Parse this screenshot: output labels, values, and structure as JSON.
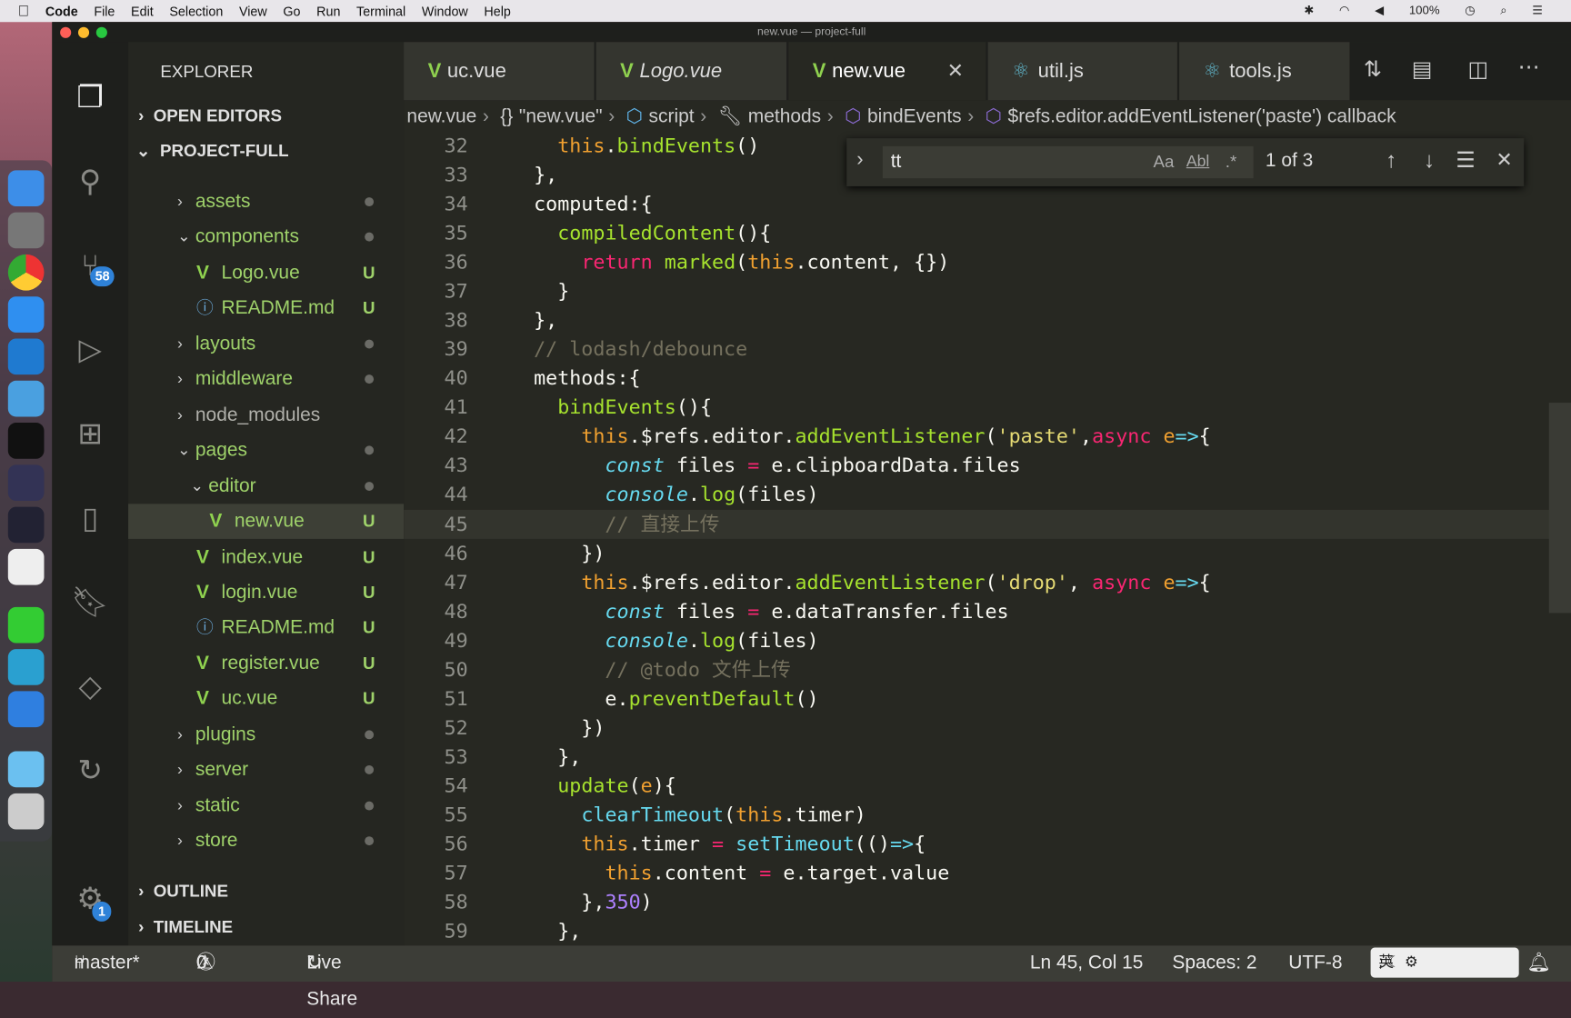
{
  "menubar": {
    "app": "Code",
    "items": [
      "File",
      "Edit",
      "Selection",
      "View",
      "Go",
      "Run",
      "Terminal",
      "Window",
      "Help"
    ],
    "battery": "100%"
  },
  "window": {
    "title": "new.vue — project-full"
  },
  "activity": {
    "scm_badge": "58",
    "settings_badge": "1"
  },
  "sidebar": {
    "title": "EXPLORER",
    "open_editors": "OPEN EDITORS",
    "project": "PROJECT-FULL",
    "outline": "OUTLINE",
    "timeline": "TIMELINE",
    "tree": [
      {
        "label": "assets",
        "type": "folder",
        "level": 1,
        "open": false,
        "status": "dot"
      },
      {
        "label": "components",
        "type": "folder",
        "level": 1,
        "open": true,
        "status": "dot"
      },
      {
        "label": "Logo.vue",
        "type": "vue",
        "level": 2,
        "status": "U"
      },
      {
        "label": "README.md",
        "type": "info",
        "level": 2,
        "status": "U"
      },
      {
        "label": "layouts",
        "type": "folder",
        "level": 1,
        "open": false,
        "status": "dot"
      },
      {
        "label": "middleware",
        "type": "folder",
        "level": 1,
        "open": false,
        "status": "dot"
      },
      {
        "label": "node_modules",
        "type": "folder",
        "level": 1,
        "open": false,
        "status": "",
        "muted": true
      },
      {
        "label": "pages",
        "type": "folder",
        "level": 1,
        "open": true,
        "status": "dot"
      },
      {
        "label": "editor",
        "type": "folder",
        "level": 2,
        "open": true,
        "status": "dot"
      },
      {
        "label": "new.vue",
        "type": "vue",
        "level": 3,
        "status": "U",
        "selected": true
      },
      {
        "label": "index.vue",
        "type": "vue",
        "level": 2,
        "status": "U"
      },
      {
        "label": "login.vue",
        "type": "vue",
        "level": 2,
        "status": "U"
      },
      {
        "label": "README.md",
        "type": "info",
        "level": 2,
        "status": "U"
      },
      {
        "label": "register.vue",
        "type": "vue",
        "level": 2,
        "status": "U"
      },
      {
        "label": "uc.vue",
        "type": "vue",
        "level": 2,
        "status": "U"
      },
      {
        "label": "plugins",
        "type": "folder",
        "level": 1,
        "open": false,
        "status": "dot"
      },
      {
        "label": "server",
        "type": "folder",
        "level": 1,
        "open": false,
        "status": "dot"
      },
      {
        "label": "static",
        "type": "folder",
        "level": 1,
        "open": false,
        "status": "dot"
      },
      {
        "label": "store",
        "type": "folder",
        "level": 1,
        "open": false,
        "status": "dot"
      }
    ]
  },
  "tabs": [
    {
      "label": "uc.vue",
      "icon": "vue"
    },
    {
      "label": "Logo.vue",
      "icon": "vue",
      "italic": true
    },
    {
      "label": "new.vue",
      "icon": "vue",
      "active": true
    },
    {
      "label": "util.js",
      "icon": "react"
    },
    {
      "label": "tools.js",
      "icon": "react"
    }
  ],
  "breadcrumb": [
    "new.vue",
    "\"new.vue\"",
    "script",
    "methods",
    "bindEvents",
    "$refs.editor.addEventListener('paste') callback"
  ],
  "find": {
    "value": "tt",
    "match_case": "Aa",
    "whole_word": "Abl",
    "regex": ".*",
    "result": "1 of 3"
  },
  "code": {
    "current_line": 45,
    "lines": [
      {
        "n": 32,
        "t": [
          [
            "    "
          ],
          [
            "this",
            "kw"
          ],
          [
            ".",
            "pl"
          ],
          [
            "bindEvents",
            "fn"
          ],
          [
            "()",
            "pl"
          ]
        ]
      },
      {
        "n": 33,
        "t": [
          [
            "  },",
            "pl"
          ]
        ]
      },
      {
        "n": 34,
        "t": [
          [
            "  computed:{",
            "pl"
          ]
        ]
      },
      {
        "n": 35,
        "t": [
          [
            "    "
          ],
          [
            "compiledContent",
            "fn"
          ],
          [
            "(){",
            "pl"
          ]
        ]
      },
      {
        "n": 36,
        "t": [
          [
            "      "
          ],
          [
            "return",
            "rd"
          ],
          [
            " "
          ],
          [
            "marked",
            "fn"
          ],
          [
            "(",
            "pl"
          ],
          [
            "this",
            "kw"
          ],
          [
            ".content, {})",
            "pl"
          ]
        ]
      },
      {
        "n": 37,
        "t": [
          [
            "    }",
            "pl"
          ]
        ]
      },
      {
        "n": 38,
        "t": [
          [
            "  },",
            "pl"
          ]
        ]
      },
      {
        "n": 39,
        "t": [
          [
            "  // lodash/debounce",
            "cm"
          ]
        ]
      },
      {
        "n": 40,
        "t": [
          [
            "  methods:{",
            "pl"
          ]
        ]
      },
      {
        "n": 41,
        "t": [
          [
            "    "
          ],
          [
            "bindEvents",
            "fn"
          ],
          [
            "(){",
            "pl"
          ]
        ]
      },
      {
        "n": 42,
        "t": [
          [
            "      "
          ],
          [
            "this",
            "kw"
          ],
          [
            ".$refs.editor.",
            "pl"
          ],
          [
            "addEventListener",
            "fn"
          ],
          [
            "(",
            "pl"
          ],
          [
            "'paste'",
            "str"
          ],
          [
            ",",
            "pl"
          ],
          [
            "async",
            "rd"
          ],
          [
            " "
          ],
          [
            "e",
            "kw"
          ],
          [
            "=>",
            "cy"
          ],
          [
            "{",
            "pl"
          ]
        ]
      },
      {
        "n": 43,
        "t": [
          [
            "        "
          ],
          [
            "const",
            "it"
          ],
          [
            " files ",
            "pl"
          ],
          [
            "=",
            "rd"
          ],
          [
            " e.clipboardData.files",
            "pl"
          ]
        ]
      },
      {
        "n": 44,
        "t": [
          [
            "        "
          ],
          [
            "console",
            "it"
          ],
          [
            ".",
            "pl"
          ],
          [
            "log",
            "fn"
          ],
          [
            "(files)",
            "pl"
          ]
        ]
      },
      {
        "n": 45,
        "t": [
          [
            "        // 直接上传",
            "cm"
          ]
        ]
      },
      {
        "n": 46,
        "t": [
          [
            "      })",
            "pl"
          ]
        ]
      },
      {
        "n": 47,
        "t": [
          [
            "      "
          ],
          [
            "this",
            "kw"
          ],
          [
            ".$refs.editor.",
            "pl"
          ],
          [
            "addEventListener",
            "fn"
          ],
          [
            "(",
            "pl"
          ],
          [
            "'drop'",
            "str"
          ],
          [
            ", ",
            "pl"
          ],
          [
            "async",
            "rd"
          ],
          [
            " "
          ],
          [
            "e",
            "kw"
          ],
          [
            "=>",
            "cy"
          ],
          [
            "{",
            "pl"
          ]
        ]
      },
      {
        "n": 48,
        "t": [
          [
            "        "
          ],
          [
            "const",
            "it"
          ],
          [
            " files ",
            "pl"
          ],
          [
            "=",
            "rd"
          ],
          [
            " e.dataTransfer.files",
            "pl"
          ]
        ]
      },
      {
        "n": 49,
        "t": [
          [
            "        "
          ],
          [
            "console",
            "it"
          ],
          [
            ".",
            "pl"
          ],
          [
            "log",
            "fn"
          ],
          [
            "(files)",
            "pl"
          ]
        ]
      },
      {
        "n": 50,
        "t": [
          [
            "        // @todo 文件上传",
            "cm"
          ]
        ]
      },
      {
        "n": 51,
        "t": [
          [
            "        e.",
            "pl"
          ],
          [
            "preventDefault",
            "fn"
          ],
          [
            "()",
            "pl"
          ]
        ]
      },
      {
        "n": 52,
        "t": [
          [
            "      })",
            "pl"
          ]
        ]
      },
      {
        "n": 53,
        "t": [
          [
            "    },",
            "pl"
          ]
        ]
      },
      {
        "n": 54,
        "t": [
          [
            "    "
          ],
          [
            "update",
            "fn"
          ],
          [
            "(",
            "pl"
          ],
          [
            "e",
            "kw"
          ],
          [
            "){",
            "pl"
          ]
        ]
      },
      {
        "n": 55,
        "t": [
          [
            "      "
          ],
          [
            "clearTimeout",
            "cy"
          ],
          [
            "(",
            "pl"
          ],
          [
            "this",
            "kw"
          ],
          [
            ".timer)",
            "pl"
          ]
        ]
      },
      {
        "n": 56,
        "t": [
          [
            "      "
          ],
          [
            "this",
            "kw"
          ],
          [
            ".timer ",
            "pl"
          ],
          [
            "=",
            "rd"
          ],
          [
            " "
          ],
          [
            "setTimeout",
            "cy"
          ],
          [
            "(()",
            "pl"
          ],
          [
            "=>",
            "cy"
          ],
          [
            "{",
            "pl"
          ]
        ]
      },
      {
        "n": 57,
        "t": [
          [
            "        "
          ],
          [
            "this",
            "kw"
          ],
          [
            ".content ",
            "pl"
          ],
          [
            "=",
            "rd"
          ],
          [
            " e.target.value",
            "pl"
          ]
        ]
      },
      {
        "n": 58,
        "t": [
          [
            "      },",
            "pl"
          ],
          [
            "350",
            "nm"
          ],
          [
            ")",
            "pl"
          ]
        ]
      },
      {
        "n": 59,
        "t": [
          [
            "    },",
            "pl"
          ]
        ]
      }
    ]
  },
  "status": {
    "branch": "master*",
    "errors": "0",
    "warnings": "0",
    "live_share": "Live Share",
    "position": "Ln 45, Col 15",
    "spaces": "Spaces: 2",
    "encoding": "UTF-8",
    "ime": "英"
  }
}
